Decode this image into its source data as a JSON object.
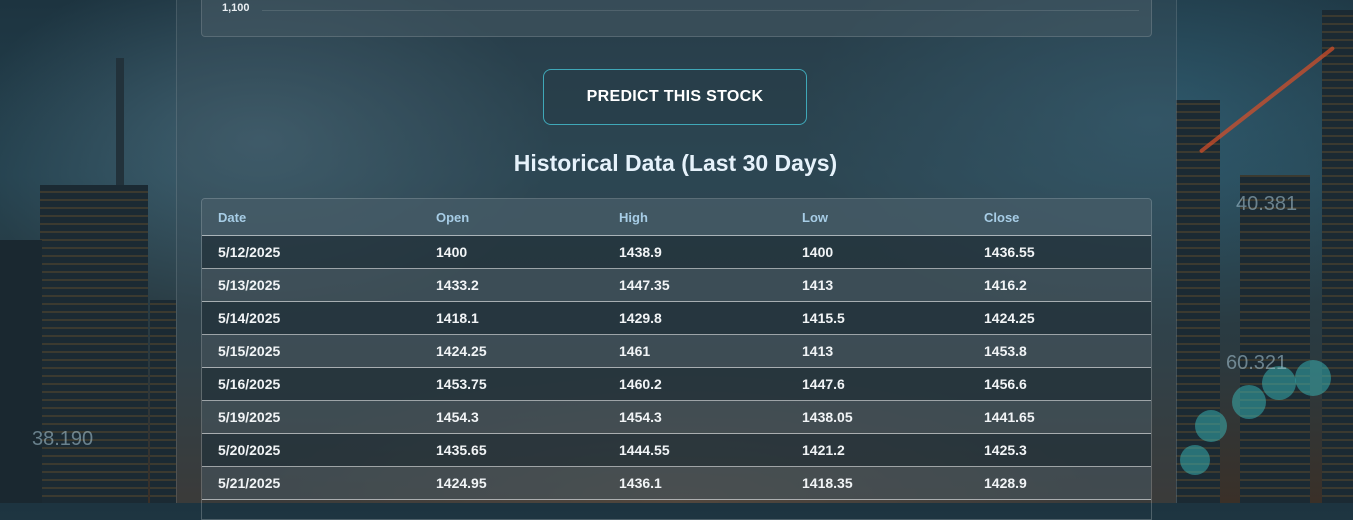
{
  "chart": {
    "y_tick": "1,100"
  },
  "predict_button": {
    "label": "PREDICT THIS STOCK"
  },
  "historical": {
    "title": "Historical Data (Last 30 Days)",
    "columns": [
      "Date",
      "Open",
      "High",
      "Low",
      "Close"
    ],
    "rows": [
      [
        "5/12/2025",
        "1400",
        "1438.9",
        "1400",
        "1436.55"
      ],
      [
        "5/13/2025",
        "1433.2",
        "1447.35",
        "1413",
        "1416.2"
      ],
      [
        "5/14/2025",
        "1418.1",
        "1429.8",
        "1415.5",
        "1424.25"
      ],
      [
        "5/15/2025",
        "1424.25",
        "1461",
        "1413",
        "1453.8"
      ],
      [
        "5/16/2025",
        "1453.75",
        "1460.2",
        "1447.6",
        "1456.6"
      ],
      [
        "5/19/2025",
        "1454.3",
        "1454.3",
        "1438.05",
        "1441.65"
      ],
      [
        "5/20/2025",
        "1435.65",
        "1444.55",
        "1421.2",
        "1425.3"
      ],
      [
        "5/21/2025",
        "1424.95",
        "1436.1",
        "1418.35",
        "1428.9"
      ]
    ]
  },
  "background": {
    "tickers": [
      "38.190",
      "40.381",
      "60.321"
    ]
  },
  "colors": {
    "accent": "#3fa8b8",
    "header_text": "#a7cde6"
  }
}
